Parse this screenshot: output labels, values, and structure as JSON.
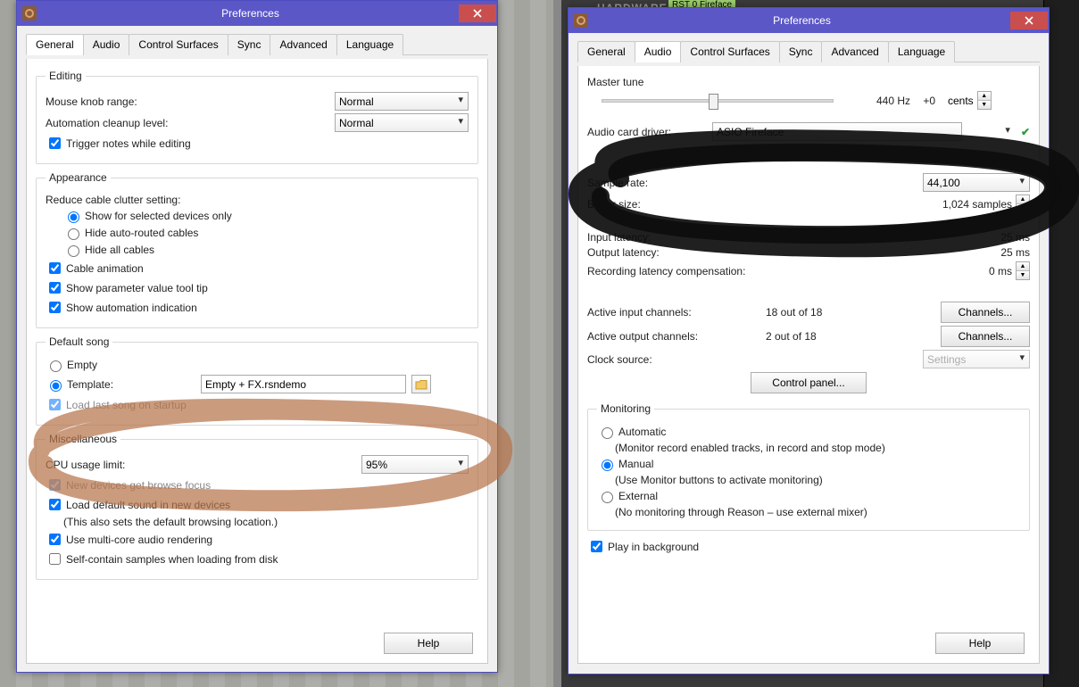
{
  "window_title": "Preferences",
  "tabs": [
    "General",
    "Audio",
    "Control Surfaces",
    "Sync",
    "Advanced",
    "Language"
  ],
  "general": {
    "editing_legend": "Editing",
    "mouse_knob": "Mouse knob range:",
    "mouse_knob_val": "Normal",
    "auto_cleanup": "Automation cleanup level:",
    "auto_cleanup_val": "Normal",
    "trigger_notes": "Trigger notes while editing",
    "appearance_legend": "Appearance",
    "reduce_cable": "Reduce cable clutter setting:",
    "rc_opt1": "Show for selected devices only",
    "rc_opt2": "Hide auto-routed cables",
    "rc_opt3": "Hide all cables",
    "cable_anim": "Cable animation",
    "param_tooltip": "Show parameter value tool tip",
    "auto_indication": "Show automation indication",
    "default_song_legend": "Default song",
    "ds_empty": "Empty",
    "ds_template": "Template:",
    "ds_template_val": "Empty + FX.rsndemo",
    "ds_load_last": "Load last song on startup",
    "misc_legend": "Miscellaneous",
    "cpu_limit": "CPU usage limit:",
    "cpu_limit_val": "95%",
    "new_devices": "New devices get browse focus",
    "load_default_sound": "Load default sound in new devices",
    "load_default_sound_note": "(This also sets the default browsing location.)",
    "multicore": "Use multi-core audio rendering",
    "selfcontain": "Self-contain samples when loading from disk"
  },
  "audio": {
    "master_tune": "Master tune",
    "tune_hz": "440 Hz",
    "tune_offset": "+0",
    "tune_unit": "cents",
    "driver_lbl": "Audio card driver:",
    "driver_val": "ASIO Fireface",
    "sample_rate": "Sample rate:",
    "sample_rate_val": "44,100",
    "buffer_size": "Buffer size:",
    "buffer_val": "1,024 samples",
    "in_latency": "Input latency:",
    "in_latency_val": "25 ms",
    "out_latency": "Output latency:",
    "out_latency_val": "25 ms",
    "rec_comp": "Recording latency compensation:",
    "rec_comp_val": "0 ms",
    "active_in": "Active input channels:",
    "active_in_val": "18 out of 18",
    "active_out": "Active output channels:",
    "active_out_val": "2 out of 18",
    "channels_btn": "Channels...",
    "clock_src": "Clock source:",
    "clock_val": "Settings",
    "ctrl_panel": "Control panel...",
    "monitoring_legend": "Monitoring",
    "mon_auto": "Automatic",
    "mon_auto_note": "(Monitor record enabled tracks, in record and stop mode)",
    "mon_manual": "Manual",
    "mon_manual_note": "(Use Monitor buttons to activate monitoring)",
    "mon_ext": "External",
    "mon_ext_note": "(No monitoring through Reason – use external mixer)",
    "play_bg": "Play in background"
  },
  "help": "Help",
  "bg_hardware": "HARDWARE",
  "bg_chip": "RST 0  Fireface"
}
